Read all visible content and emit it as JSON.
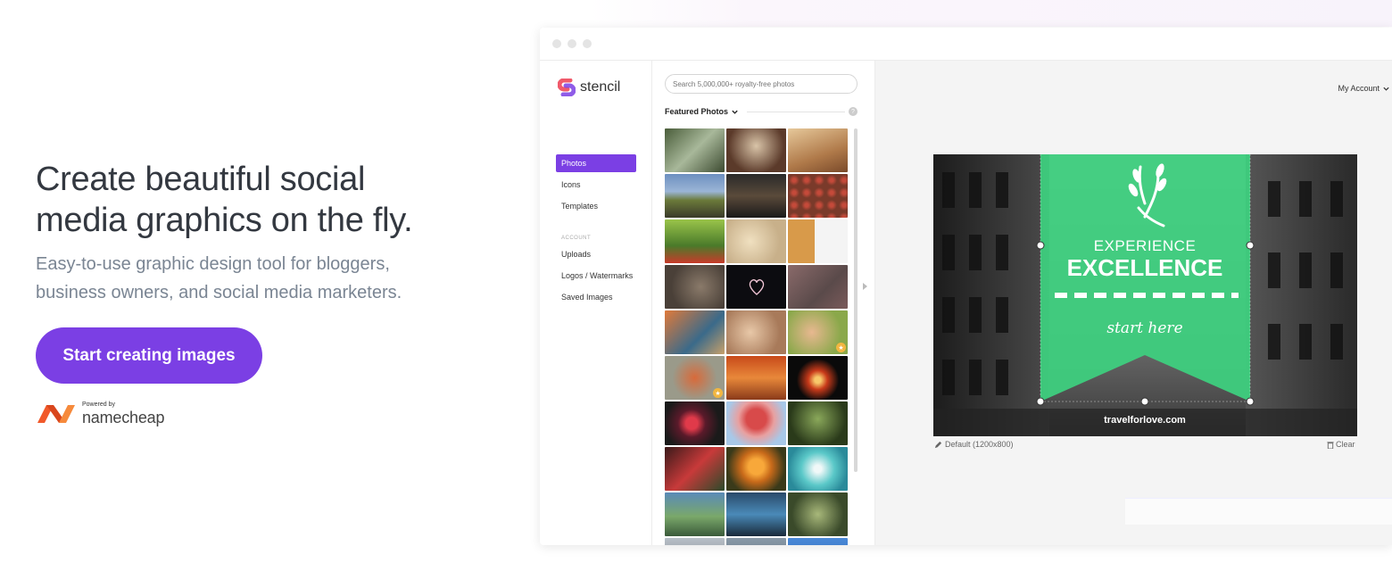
{
  "hero": {
    "title_line1": "Create beautiful social",
    "title_line2": "media graphics on the fly.",
    "subtitle_line1": "Easy-to-use graphic design tool for bloggers,",
    "subtitle_line2": "business owners, and social media marketers.",
    "cta_label": "Start creating images",
    "powered_by": "Powered by",
    "partner_name": "namecheap"
  },
  "app": {
    "brand": "stencil",
    "nav": {
      "items": [
        {
          "label": "Photos",
          "active": true
        },
        {
          "label": "Icons"
        },
        {
          "label": "Templates"
        }
      ],
      "section_label": "ACCOUNT",
      "account_items": [
        {
          "label": "Uploads"
        },
        {
          "label": "Logos / Watermarks"
        },
        {
          "label": "Saved Images"
        }
      ]
    },
    "photos": {
      "search_placeholder": "Search 5,000,000+ royalty-free photos",
      "featured_label": "Featured Photos",
      "help_glyph": "?"
    },
    "account_label": "My Account",
    "canvas": {
      "size_label": "Default (1200x800)",
      "clear_label": "Clear",
      "design": {
        "headline_top": "EXPERIENCE",
        "headline_main": "EXCELLENCE",
        "script_text": "start here",
        "url_text": "travelforlove.com"
      }
    }
  },
  "colors": {
    "brand_purple": "#7b3fe4",
    "banner_green": "#3ecf7e",
    "namecheap_orange": "#f1592a"
  }
}
